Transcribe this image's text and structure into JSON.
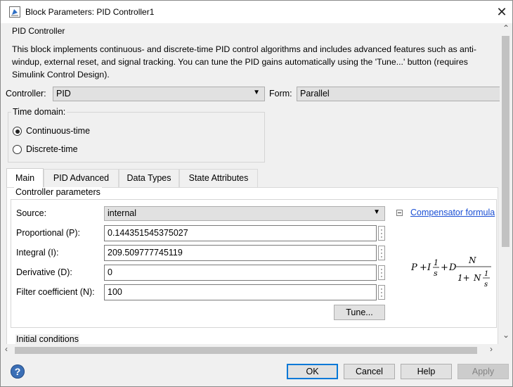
{
  "window": {
    "title": "Block Parameters: PID Controller1"
  },
  "block": {
    "group_label": "PID Controller",
    "description_lines": [
      "This block implements continuous- and discrete-time PID control algorithms and includes advanced features such as anti-",
      "windup, external reset, and signal tracking. You can tune the PID gains automatically using the 'Tune...' button (requires",
      "Simulink Control Design)."
    ]
  },
  "controller": {
    "label": "Controller:",
    "value": "PID"
  },
  "form": {
    "label": "Form:",
    "value": "Parallel"
  },
  "time_domain": {
    "legend": "Time domain:",
    "options": [
      {
        "label": "Continuous-time",
        "selected": true
      },
      {
        "label": "Discrete-time",
        "selected": false
      }
    ]
  },
  "tabs": [
    {
      "label": "Main",
      "active": true
    },
    {
      "label": "PID Advanced",
      "active": false
    },
    {
      "label": "Data Types",
      "active": false
    },
    {
      "label": "State Attributes",
      "active": false
    }
  ],
  "controller_parameters": {
    "legend": "Controller parameters",
    "source_label": "Source:",
    "source_value": "internal",
    "params": [
      {
        "label": "Proportional (P):",
        "value": "0.144351545375027"
      },
      {
        "label": "Integral (I):",
        "value": "209.509777745119"
      },
      {
        "label": "Derivative (D):",
        "value": "0"
      },
      {
        "label": "Filter coefficient (N):",
        "value": "100"
      }
    ],
    "tune_label": "Tune...",
    "compensator_link": "Compensator formula"
  },
  "formula": {
    "P": "P",
    "plus": "+",
    "I": "I",
    "one": "1",
    "s": "s",
    "D": "D",
    "N": "N",
    "one_plus": "1+",
    "N2": "N"
  },
  "initial_conditions_label": "Initial conditions",
  "buttons": {
    "ok": "OK",
    "cancel": "Cancel",
    "help": "Help",
    "apply": "Apply"
  },
  "icons": {
    "help": "?",
    "close": "✕"
  }
}
